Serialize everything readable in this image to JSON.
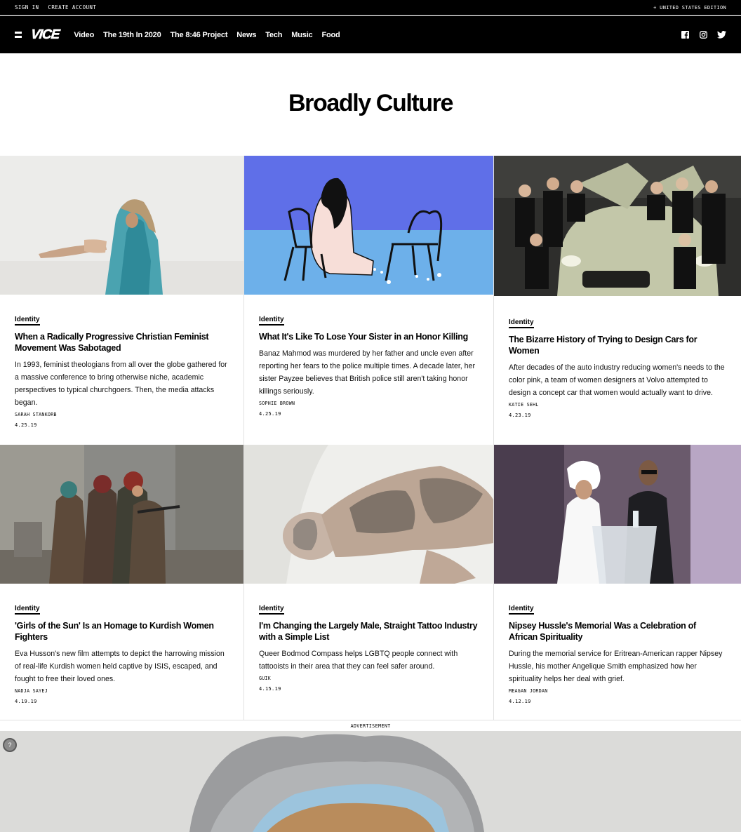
{
  "utility": {
    "sign_in": "SIGN IN",
    "create_account": "CREATE ACCOUNT",
    "edition": "+ UNITED STATES EDITION"
  },
  "nav": {
    "logo": "VICE",
    "items": [
      "Video",
      "The 19th In 2020",
      "The 8:46 Project",
      "News",
      "Tech",
      "Music",
      "Food"
    ],
    "social_icons": [
      "facebook-icon",
      "instagram-icon",
      "twitter-icon"
    ]
  },
  "page": {
    "title": "Broadly Culture"
  },
  "articles": [
    {
      "tag": "Identity",
      "title": "When a Radically Progressive Christian Feminist Movement Was Sabotaged",
      "description": "In 1993, feminist theologians from all over the globe gathered for a massive conference to bring otherwise niche, academic perspectives to typical churchgoers. Then, the media attacks began.",
      "author": "SARAH STANKORB",
      "date": "4.25.19"
    },
    {
      "tag": "Identity",
      "title": "What It's Like To Lose Your Sister in an Honor Killing",
      "description": "Banaz Mahmod was murdered by her father and uncle even after reporting her fears to the police multiple times. A decade later, her sister Payzee believes that British police still aren't taking honor killings seriously.",
      "author": "SOPHIE BROWN",
      "date": "4.25.19"
    },
    {
      "tag": "Identity",
      "title": "The Bizarre History of Trying to Design Cars for Women",
      "description": "After decades of the auto industry reducing women's needs to the color pink, a team of women designers at Volvo attempted to design a concept car that women would actually want to drive.",
      "author": "KATIE SEHL",
      "date": "4.23.19"
    },
    {
      "tag": "Identity",
      "title": "'Girls of the Sun' Is an Homage to Kurdish Women Fighters",
      "description": "Eva Husson's new film attempts to depict the harrowing mission of real-life Kurdish women held captive by ISIS, escaped, and fought to free their loved ones.",
      "author": "NADJA SAYEJ",
      "date": "4.19.19"
    },
    {
      "tag": "Identity",
      "title": "I'm Changing the Largely Male, Straight Tattoo Industry with a Simple List",
      "description": "Queer Bodmod Compass helps LGBTQ people connect with tattooists in their area that they can feel safer around.",
      "author": "GUIK",
      "date": "4.15.19"
    },
    {
      "tag": "Identity",
      "title": "Nipsey Hussle's Memorial Was a Celebration of African Spirituality",
      "description": "During the memorial service for Eritrean-American rapper Nipsey Hussle, his mother Angelique Smith emphasized how her spirituality helps her deal with grief.",
      "author": "MEAGAN JORDAN",
      "date": "4.12.19"
    }
  ],
  "ad": {
    "label": "ADVERTISEMENT",
    "help": "?"
  }
}
